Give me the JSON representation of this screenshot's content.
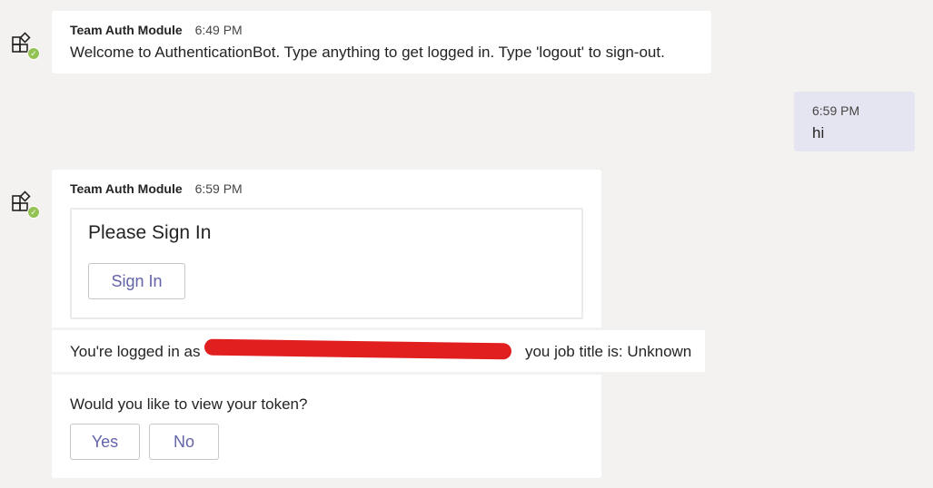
{
  "colors": {
    "background": "#f3f2f1",
    "card": "#ffffff",
    "user_bubble": "#e5e5f1",
    "accent": "#6264a7",
    "presence_available": "#92c353",
    "redaction": "#e11f1f"
  },
  "messages": {
    "welcome": {
      "sender": "Team Auth Module",
      "time": "6:49 PM",
      "text": "Welcome to AuthenticationBot. Type anything to get logged in. Type 'logout' to sign-out."
    },
    "user_reply": {
      "time": "6:59 PM",
      "text": "hi"
    },
    "signin": {
      "sender": "Team Auth Module",
      "time": "6:59 PM",
      "card_title": "Please Sign In",
      "button_label": "Sign In"
    },
    "logged_in": {
      "text_before": "You're logged in as",
      "text_after": "you job title is: Unknown"
    },
    "token_prompt": {
      "question": "Would you like to view your token?",
      "yes_label": "Yes",
      "no_label": "No"
    }
  },
  "icons": {
    "bot_avatar": "apps-icon",
    "presence": "available-status-icon"
  }
}
